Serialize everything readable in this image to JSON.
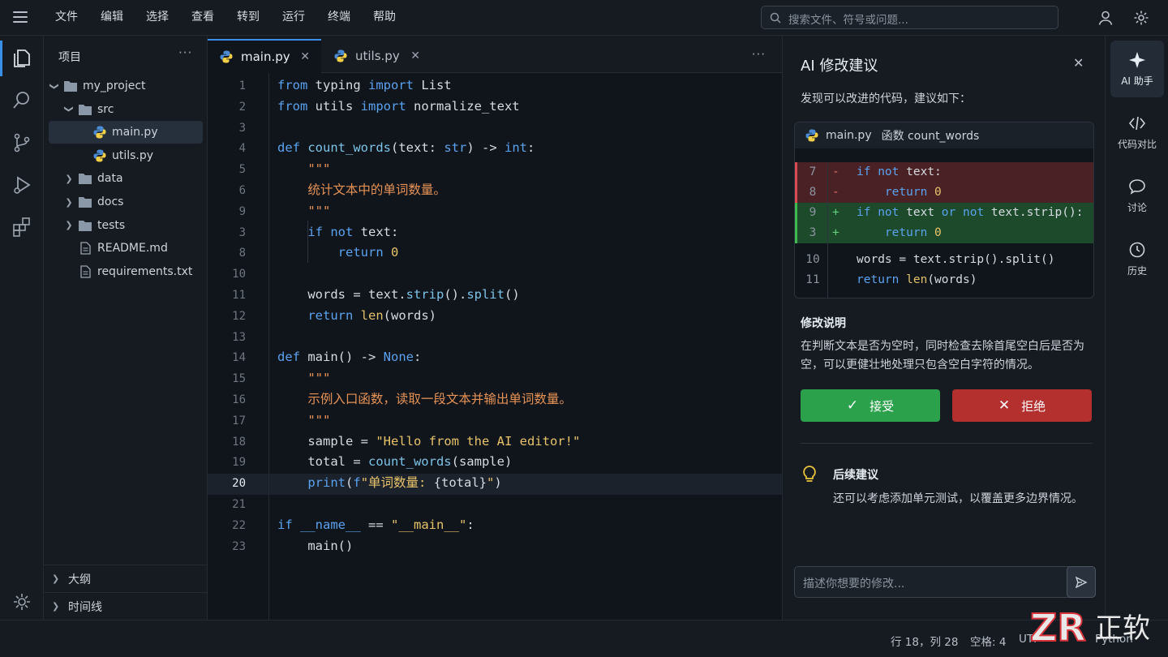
{
  "menu": [
    "文件",
    "编辑",
    "选择",
    "查看",
    "转到",
    "运行",
    "终端",
    "帮助"
  ],
  "search": {
    "placeholder": "搜索文件、符号或问题..."
  },
  "explorer": {
    "title": "项目",
    "more": "···",
    "tree": [
      {
        "label": "my_project",
        "type": "folder",
        "expanded": true
      },
      {
        "label": "src",
        "type": "folder",
        "expanded": true
      },
      {
        "label": "main.py",
        "type": "python",
        "selected": true
      },
      {
        "label": "utils.py",
        "type": "python"
      },
      {
        "label": "data",
        "type": "folder",
        "expanded": false
      },
      {
        "label": "docs",
        "type": "folder",
        "expanded": false
      },
      {
        "label": "tests",
        "type": "folder",
        "expanded": false
      },
      {
        "label": "README.md",
        "type": "file"
      },
      {
        "label": "requirements.txt",
        "type": "file"
      }
    ],
    "outline": "大纲",
    "timeline": "时间线"
  },
  "tabs": [
    {
      "label": "main.py",
      "active": true,
      "close": "✕"
    },
    {
      "label": "utils.py",
      "active": false,
      "close": "✕"
    }
  ],
  "editor": {
    "current_line": 20,
    "line_numbers": [
      "1",
      "2",
      "3",
      "4",
      "5",
      "6",
      "9",
      "3",
      "8",
      "10",
      "11",
      "12",
      "13",
      "14",
      "15",
      "16",
      "17",
      "18",
      "19",
      "20",
      "21",
      "22",
      "23"
    ],
    "lines": [
      [
        [
          "kw",
          "from"
        ],
        [
          "pl",
          " typing "
        ],
        [
          "kw",
          "import"
        ],
        [
          "pl",
          " List"
        ]
      ],
      [
        [
          "kw",
          "from"
        ],
        [
          "pl",
          " utils "
        ],
        [
          "kw",
          "import"
        ],
        [
          "pl",
          " normalize_text"
        ]
      ],
      [],
      [
        [
          "kw",
          "def"
        ],
        [
          "pl",
          " "
        ],
        [
          "fn",
          "count_words"
        ],
        [
          "pl",
          "(text: "
        ],
        [
          "kw",
          "str"
        ],
        [
          "pl",
          ") -> "
        ],
        [
          "kw",
          "int"
        ],
        [
          "pl",
          ":"
        ]
      ],
      [
        [
          "pl",
          "    "
        ],
        [
          "cm",
          "\"\"\""
        ]
      ],
      [
        [
          "pl",
          "    "
        ],
        [
          "cm",
          "统计文本中的单词数量。"
        ]
      ],
      [
        [
          "pl",
          "    "
        ],
        [
          "cm",
          "\"\"\""
        ]
      ],
      [
        [
          "pl",
          "    "
        ],
        [
          "kw",
          "if"
        ],
        [
          "pl",
          " "
        ],
        [
          "kw",
          "not"
        ],
        [
          "pl",
          " text:"
        ]
      ],
      [
        [
          "pl",
          "        "
        ],
        [
          "kw",
          "return"
        ],
        [
          "pl",
          " "
        ],
        [
          "nm",
          "0"
        ]
      ],
      [],
      [
        [
          "pl",
          "    words = text."
        ],
        [
          "fn",
          "strip"
        ],
        [
          "pl",
          "()."
        ],
        [
          "fn",
          "split"
        ],
        [
          "pl",
          "()"
        ]
      ],
      [
        [
          "pl",
          "    "
        ],
        [
          "kw",
          "return"
        ],
        [
          "pl",
          " "
        ],
        [
          "bi",
          "len"
        ],
        [
          "pl",
          "(words)"
        ]
      ],
      [],
      [
        [
          "kw",
          "def"
        ],
        [
          "pl",
          " main() -> "
        ],
        [
          "kw",
          "None"
        ],
        [
          "pl",
          ":"
        ]
      ],
      [
        [
          "pl",
          "    "
        ],
        [
          "cm",
          "\"\"\""
        ]
      ],
      [
        [
          "pl",
          "    "
        ],
        [
          "cm",
          "示例入口函数，读取一段文本并输出单词数量。"
        ]
      ],
      [
        [
          "pl",
          "    "
        ],
        [
          "cm",
          "\"\"\""
        ]
      ],
      [
        [
          "pl",
          "    sample = "
        ],
        [
          "st",
          "\"Hello from the AI editor!\""
        ]
      ],
      [
        [
          "pl",
          "    total = "
        ],
        [
          "fn",
          "count_words"
        ],
        [
          "pl",
          "(sample)"
        ]
      ],
      [
        [
          "pl",
          "    "
        ],
        [
          "kw",
          "print"
        ],
        [
          "pl",
          "("
        ],
        [
          "kw",
          "f"
        ],
        [
          "st",
          "\"单词数量: "
        ],
        [
          "pl",
          "{total}"
        ],
        [
          "st",
          "\""
        ],
        [
          "pl",
          ")"
        ]
      ],
      [],
      [
        [
          "kw",
          "if"
        ],
        [
          "pl",
          " "
        ],
        [
          "kw",
          "__name__"
        ],
        [
          "pl",
          " == "
        ],
        [
          "st",
          "\"__main__\""
        ],
        [
          "pl",
          ":"
        ]
      ],
      [
        [
          "pl",
          "    main()"
        ]
      ]
    ]
  },
  "ai_panel": {
    "title": "AI 修改建议",
    "close": "✕",
    "subtitle": "发现可以改进的代码，建议如下：",
    "diff": {
      "file": "main.py",
      "function": "函数 count_words",
      "rows": [
        {
          "kind": "del",
          "num": "7",
          "sign": "-",
          "tokens": [
            [
              "kw",
              "if"
            ],
            [
              "pl",
              " "
            ],
            [
              "kw",
              "not"
            ],
            [
              "pl",
              " text:"
            ]
          ]
        },
        {
          "kind": "del",
          "num": "8",
          "sign": "-",
          "tokens": [
            [
              "pl",
              "    "
            ],
            [
              "kw",
              "return"
            ],
            [
              "pl",
              " "
            ],
            [
              "nm",
              "0"
            ]
          ]
        },
        {
          "kind": "add",
          "num": "9",
          "sign": "+",
          "tokens": [
            [
              "kw",
              "if"
            ],
            [
              "pl",
              " "
            ],
            [
              "kw",
              "not"
            ],
            [
              "pl",
              " text "
            ],
            [
              "kw",
              "or"
            ],
            [
              "pl",
              " "
            ],
            [
              "kw",
              "not"
            ],
            [
              "pl",
              " text.strip():"
            ]
          ]
        },
        {
          "kind": "add",
          "num": "3",
          "sign": "+",
          "tokens": [
            [
              "pl",
              "    "
            ],
            [
              "kw",
              "return"
            ],
            [
              "pl",
              " "
            ],
            [
              "nm",
              "0"
            ]
          ]
        },
        {
          "kind": "ctx",
          "num": "10",
          "sign": "",
          "tokens": [
            [
              "pl",
              "words = text.strip().split()"
            ]
          ]
        },
        {
          "kind": "ctx",
          "num": "11",
          "sign": "",
          "tokens": [
            [
              "kw",
              "return"
            ],
            [
              "pl",
              " "
            ],
            [
              "bi",
              "len"
            ],
            [
              "pl",
              "(words)"
            ]
          ]
        }
      ]
    },
    "explain_title": "修改说明",
    "explain_text": "在判断文本是否为空时，同时检查去除首尾空白后是否为空，可以更健壮地处理只包含空白字符的情况。",
    "accept": "接受",
    "reject": "拒绝",
    "next_title": "后续建议",
    "next_text": "还可以考虑添加单元测试，以覆盖更多边界情况。",
    "input_placeholder": "描述你想要的修改..."
  },
  "right_bar": [
    {
      "label": "AI 助手",
      "icon": "sparkle-icon",
      "selected": true
    },
    {
      "label": "代码对比",
      "icon": "compare-icon"
    },
    {
      "label": "讨论",
      "icon": "chat-icon"
    },
    {
      "label": "历史",
      "icon": "clock-icon"
    }
  ],
  "status": {
    "position": "行 18，列 28",
    "spaces": "空格: 4",
    "encoding": "UTF",
    "lang": "Python"
  },
  "colors": {
    "accent": "#3a8fe8",
    "accept": "#2aa14a",
    "reject": "#b3302f"
  }
}
